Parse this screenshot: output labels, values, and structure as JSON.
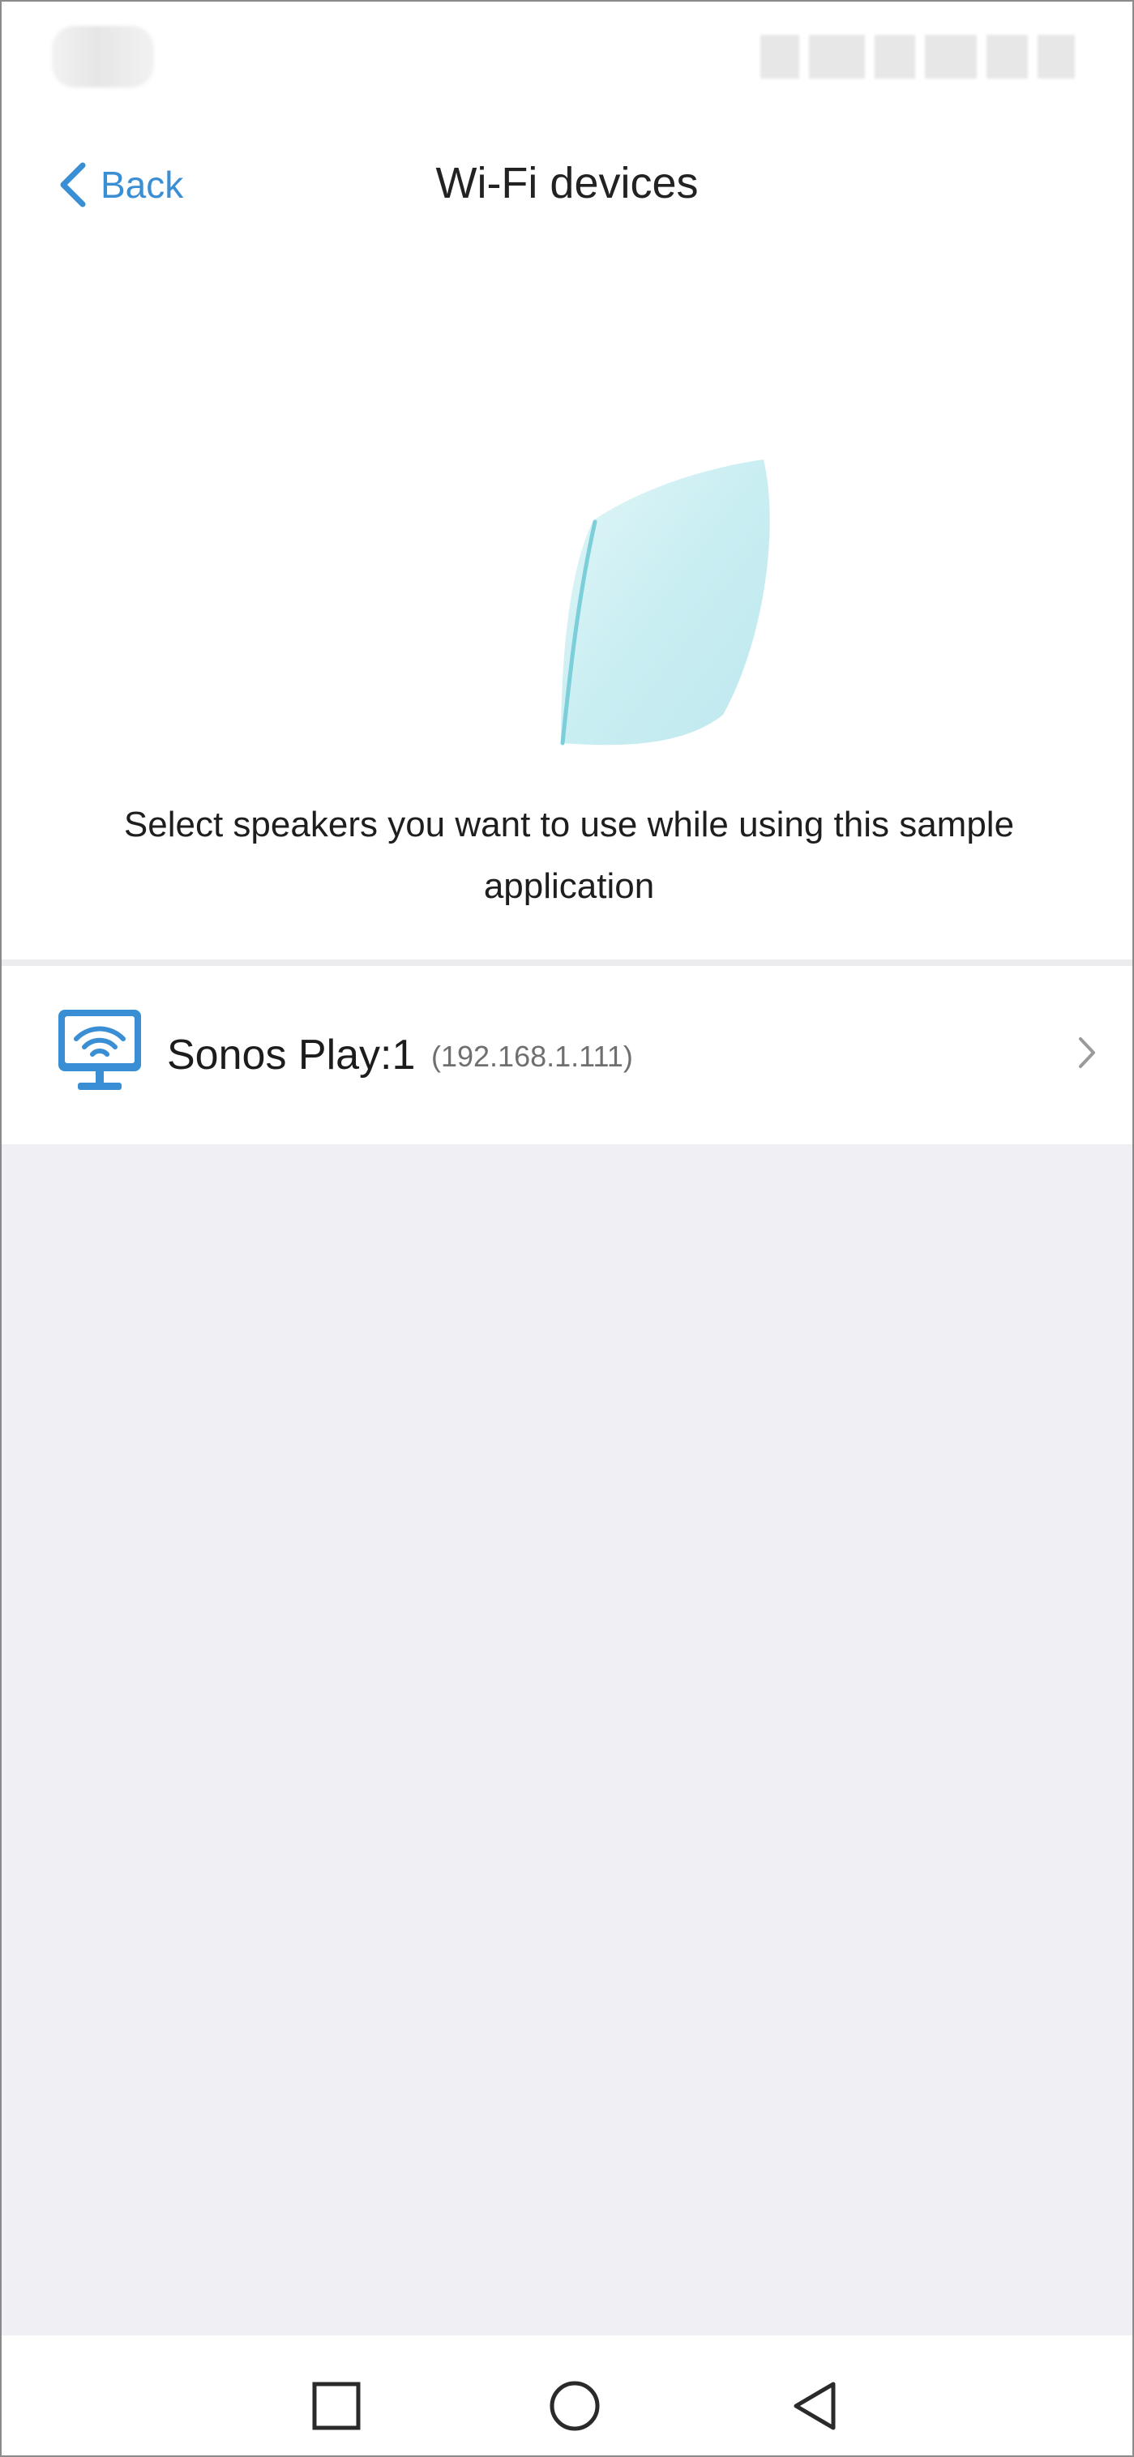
{
  "header": {
    "back_label": "Back",
    "title": "Wi-Fi devices"
  },
  "instruction": "Select speakers you want to use while using this sample application",
  "devices": [
    {
      "name": "Sonos Play:1",
      "ip": "(192.168.1.111)",
      "icon": "wifi-monitor-icon"
    }
  ],
  "colors": {
    "accent": "#3a8fd4",
    "list_background": "#efeff4",
    "illustration": "#bfe8ee"
  },
  "navbar": {
    "icons": [
      "recents-icon",
      "home-icon",
      "back-triangle-icon"
    ]
  }
}
